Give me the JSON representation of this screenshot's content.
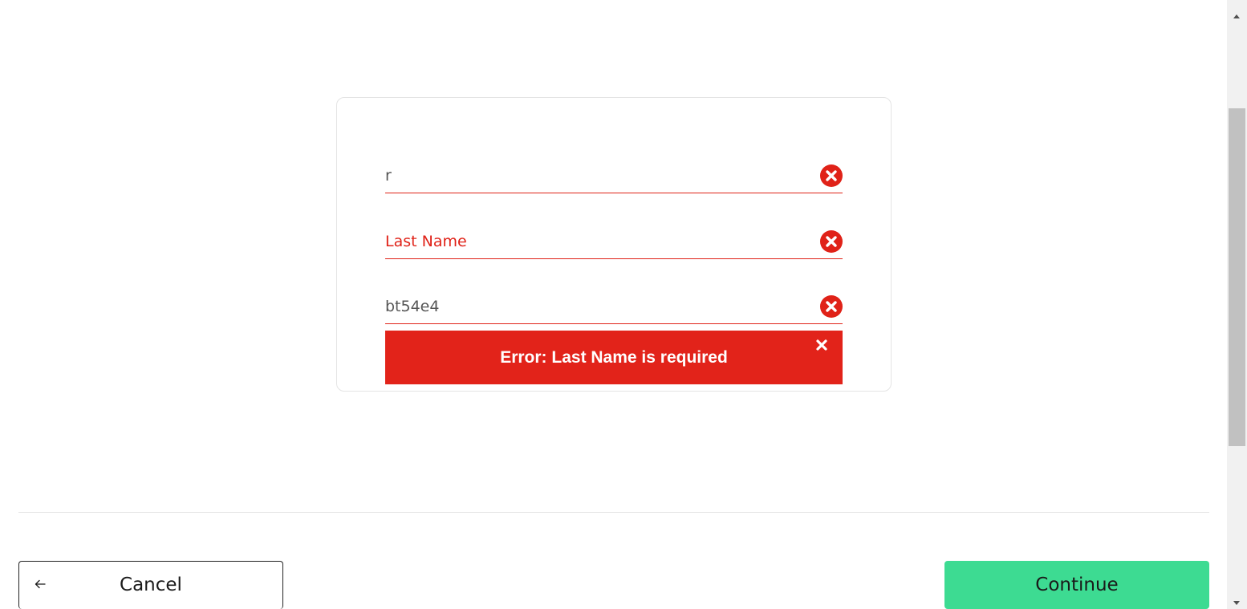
{
  "form": {
    "first_name_value": "r",
    "last_name_value": "",
    "last_name_placeholder": "Last Name",
    "third_field_value": "bt54e4",
    "error_message": "Error: Last Name is required"
  },
  "footer": {
    "cancel_label": "Cancel",
    "continue_label": "Continue"
  },
  "icons": {
    "field_error": "error-circle-x-icon",
    "banner_close": "close-icon",
    "back": "arrow-left-icon"
  },
  "colors": {
    "error": "#e2231a",
    "primary": "#3ddb92"
  }
}
